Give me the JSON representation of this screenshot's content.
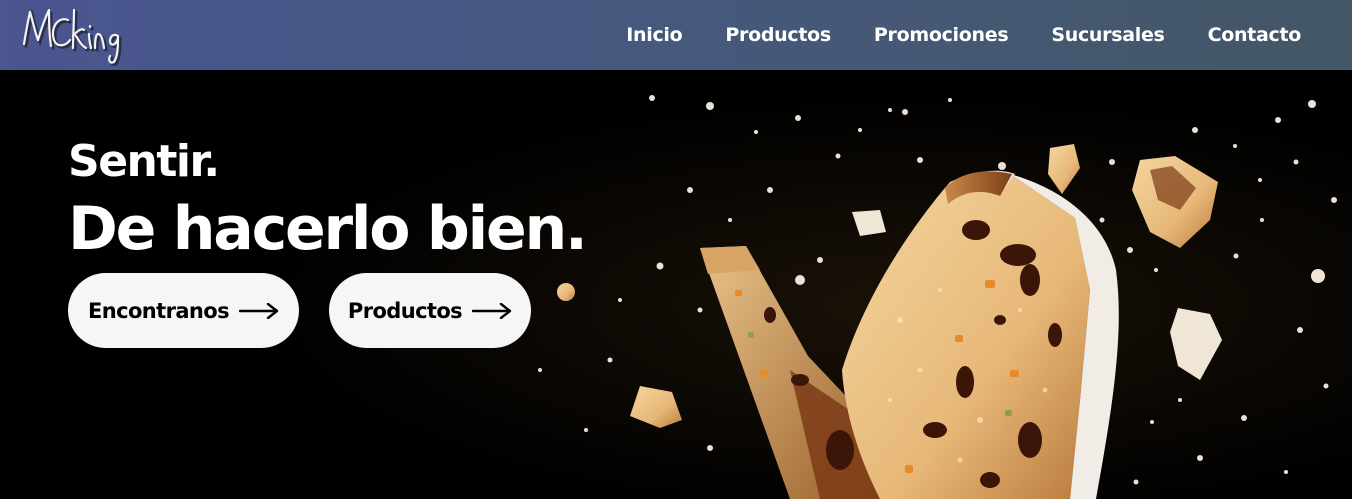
{
  "brand": {
    "logo_text": "MCking",
    "logo_icon": "script-wordmark"
  },
  "nav": {
    "items": [
      {
        "label": "Inicio"
      },
      {
        "label": "Productos"
      },
      {
        "label": "Promociones"
      },
      {
        "label": "Sucursales"
      },
      {
        "label": "Contacto"
      }
    ]
  },
  "hero": {
    "headline_small": "Sentir.",
    "headline_large": "De hacerlo bien.",
    "buttons": [
      {
        "label": "Encontranos",
        "icon": "arrow-right-icon"
      },
      {
        "label": "Productos",
        "icon": "arrow-right-icon"
      }
    ]
  },
  "colors": {
    "navbar_start": "#4a5591",
    "navbar_end": "#435766",
    "hero_bg": "#000000",
    "button_bg": "#f6f6f6",
    "text_light": "#ffffff"
  }
}
